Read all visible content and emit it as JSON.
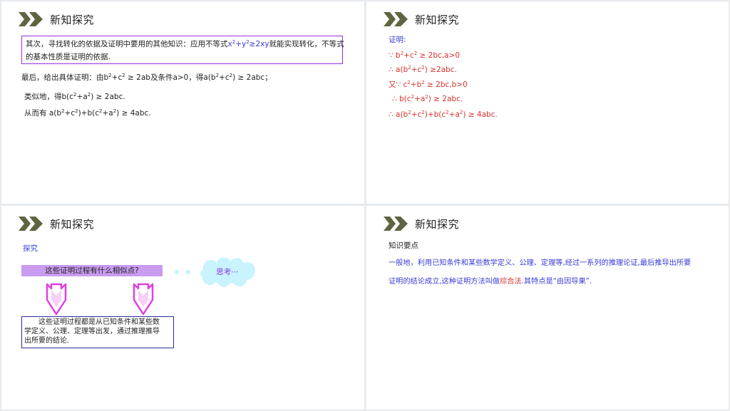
{
  "slides": [
    {
      "title": "新知探究",
      "box_text_a": "其次，寻找转化的依据及证明中要用的其他知识：应用不等式",
      "box_formula": {
        "a": "x",
        "b": "+y",
        "c": "≥2xy"
      },
      "box_text_b": "就能实现转化，不等式",
      "box_line2": "的基本性质是证明的依据.",
      "para1": {
        "a": "最后，给出具体证明：由b",
        "b": "+c",
        "c": " ≥ 2ab及条件a>0，得a(b",
        "d": "+c",
        "e": ") ≥ 2abc；"
      },
      "para2": {
        "a": "类似地，得b(c",
        "b": "+a",
        "c": ") ≥ 2abc."
      },
      "para3": {
        "a": "从而有 a(b",
        "b": "+c",
        "c": ")+b(c",
        "d": "+a",
        "e": ") ≥ 4abc."
      }
    },
    {
      "title": "新知探究",
      "proof_label": "证明:",
      "line1": {
        "a": "∵ b",
        "b": "+c",
        "c": " ≥ 2bc,a>0"
      },
      "line2": {
        "a": "∴ a(b",
        "b": "+c",
        "c": ") ≥2abc."
      },
      "line3": {
        "a": "又∵ c",
        "b": "+b",
        "c": " ≥ 2bc,b>0"
      },
      "line4": {
        "a": "∴ b(c",
        "b": "+a",
        "c": ") ≥ 2abc."
      },
      "line5": {
        "a": "∴ a(b",
        "b": "+c",
        "c": ")+b(c",
        "d": "+a",
        "e": ") ≥ 4abc."
      }
    },
    {
      "title": "新知探究",
      "explore_label": "探究",
      "question": "这些证明过程有什么相似点?",
      "think": "思考⋯",
      "answer_line1": "这些证明过程都是从已知条件和某些数",
      "answer_line2": "学定义、公理、定理等出发，通过推理推导",
      "answer_line3": "出所要的结论."
    },
    {
      "title": "新知探究",
      "point_label": "知识要点",
      "line1": "一般地，利用已知条件和某些数学定义、公理、定理等,经过一系列的推理论证,最后推导出所要",
      "line2_a": "证明的结论成立,这种证明方法叫做",
      "line2_b": "综合法",
      "line2_c": ".其特点是“由因导果”."
    }
  ],
  "sup": "2",
  "colors": {
    "chevron": "#5f6540",
    "blue_text": "#3a3ad6",
    "red_text": "#d9302b",
    "purple_border": "#9b30e0",
    "question_bar": "#c99cf0",
    "arrow": "#e040e0",
    "cloud": "#c8f3ff",
    "answer_border": "#2c2c9e"
  }
}
